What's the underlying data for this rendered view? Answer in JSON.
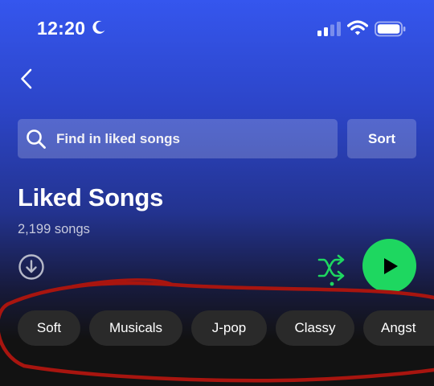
{
  "status_bar": {
    "time": "12:20",
    "icons": [
      "moon-icon",
      "cellular-signal-icon",
      "wifi-icon",
      "battery-icon"
    ]
  },
  "header": {
    "back_icon": "chevron-left-icon"
  },
  "search": {
    "placeholder": "Find in liked songs",
    "value": ""
  },
  "sort_label": "Sort",
  "playlist": {
    "title": "Liked Songs",
    "song_count": "2,199 songs"
  },
  "actions": {
    "download_icon": "download-icon",
    "shuffle_icon": "shuffle-icon",
    "play_icon": "play-icon"
  },
  "filters": [
    "Soft",
    "Musicals",
    "J-pop",
    "Classy",
    "Angst"
  ],
  "colors": {
    "accent": "#1ed760",
    "chip_background": "#2a2a2a",
    "annotation": "#a8150f",
    "gradient_top": "#3556ee",
    "background": "#121212"
  }
}
